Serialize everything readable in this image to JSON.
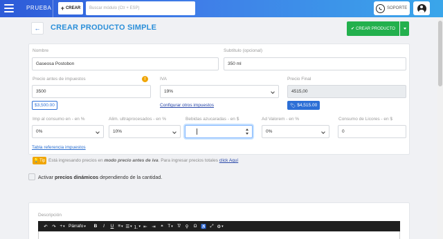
{
  "navbar": {
    "brand": "PRUEBA",
    "create_label": "CREAR",
    "search_placeholder": "Buscar módulo (Ctr + ESP)",
    "support_label": "SOPORTE"
  },
  "header": {
    "title": "CREAR PRODUCTO SIMPLE",
    "create_button": "CREAR PRODUCTO"
  },
  "form": {
    "nombre": {
      "label": "Nombre",
      "value": "Gaseosa Postobon"
    },
    "subtitulo": {
      "label": "Subtítulo (opcional)",
      "value": "350 ml"
    },
    "precio_antes": {
      "label": "Precio antes de impuestos",
      "value": "3500",
      "badge": "$3,500.00"
    },
    "iva": {
      "label": "IVA",
      "value": "19%"
    },
    "precio_final": {
      "label": "Precio Final",
      "value": "4515,00",
      "badge": "$4,515.00"
    },
    "config_link": "Configurar otros impuestos",
    "impoconsumo": {
      "label": "Imp al consumo en - en %",
      "value": "0%"
    },
    "ultraprocesados": {
      "label": "Alim. ultraprocesados - en %",
      "value": "10%"
    },
    "azucaradas": {
      "label": "Bebidas azucaradas - en $",
      "value": ""
    },
    "ad_valorem": {
      "label": "Ad Valorem - en %",
      "value": "0%"
    },
    "licores": {
      "label": "Consumo de Licores - en $",
      "value": "0"
    },
    "tabla_link": "Tabla referencia impuestos"
  },
  "tip": {
    "badge": "Tip",
    "text_pre": "Está ingresando precios en ",
    "text_bold": "modo precio antes de iva",
    "text_post": ". Para ingresar precios totales ",
    "link": "click Aquí"
  },
  "dynamic_prices": {
    "pre": "Activar ",
    "bold": "precios dinámicos",
    "post": " dependiendo de la cantidad."
  },
  "description": {
    "label": "Descripción",
    "toolbar_format": "Párrafo"
  },
  "colors": {
    "accent": "#2b8fd9",
    "success": "#23b04d",
    "warning": "#f0a500",
    "link": "#2746a8"
  }
}
